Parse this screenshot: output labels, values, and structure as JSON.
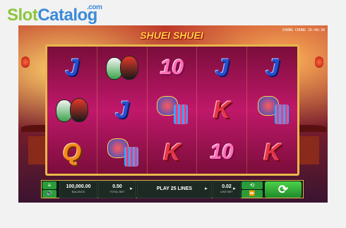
{
  "watermark": {
    "slot": "Slot",
    "catalog": "Catalog",
    "com": ".com"
  },
  "game": {
    "title": "SHUEI SHUEI",
    "clock": "CHUNG CHUNG 16:48:38"
  },
  "reels": [
    [
      "J",
      "mask",
      "10",
      "J",
      "J"
    ],
    [
      "mask",
      "J",
      "lion",
      "K",
      "lion"
    ],
    [
      "Q",
      "lion",
      "K",
      "10",
      "K"
    ]
  ],
  "controls": {
    "menu_icon": "≡",
    "sound_icon": "🔊",
    "balance_value": "100,000.00",
    "balance_label": "BALANCE",
    "total_bet_value": "0.50",
    "total_bet_label": "TOTAL BET",
    "lines_label": "PLAY 25 LINES",
    "line_bet_value": "0.02",
    "line_bet_label": "LINE BET",
    "autoplay_icon": "⟲",
    "fast_icon": "⏩",
    "spin_icon": "⟳",
    "arrow": "▸"
  }
}
